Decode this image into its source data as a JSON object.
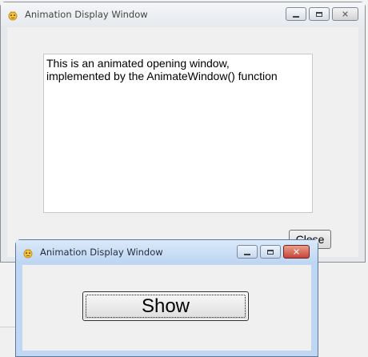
{
  "back_window": {
    "title": "Animation Display Window",
    "app_icon": "app-icon",
    "caption_buttons": {
      "minimize_icon": "minimize-icon",
      "maximize_icon": "maximize-icon",
      "close_icon": "close-icon"
    },
    "text_lines": [
      "This is an animated opening window,",
      "implemented by the AnimateWindow() function"
    ],
    "close_button_label": "Close"
  },
  "front_window": {
    "title": "Animation Display Window",
    "app_icon": "app-icon",
    "caption_buttons": {
      "minimize_icon": "minimize-icon",
      "maximize_icon": "maximize-icon",
      "close_icon": "close-icon"
    },
    "show_button_label": "Show"
  },
  "colors": {
    "front_title_bar": "#bdd5f2",
    "front_close_button": "#c94438",
    "client_background": "#f0f0f0"
  }
}
